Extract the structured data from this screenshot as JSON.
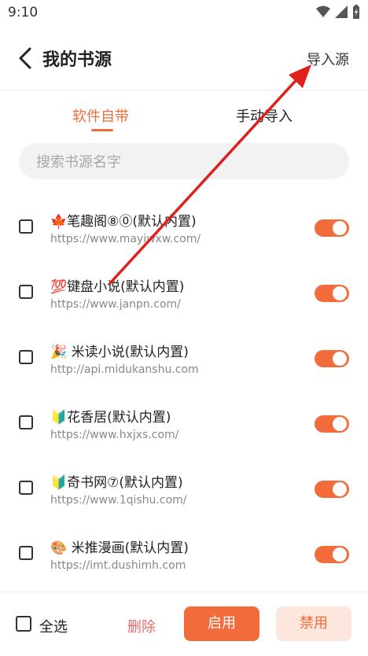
{
  "status": {
    "time": "9:10"
  },
  "header": {
    "title": "我的书源",
    "import_label": "导入源"
  },
  "tabs": [
    {
      "label": "软件自带"
    },
    {
      "label": "手动导入"
    }
  ],
  "search": {
    "placeholder": "搜索书源名字"
  },
  "sources": [
    {
      "emoji": "🍁",
      "name": "笔趣阁⑧⓪(默认内置)",
      "url": "https://www.mayiwxw.com/",
      "enabled": true
    },
    {
      "emoji": "💯",
      "name": "键盘小说(默认内置)",
      "url": "https://www.janpn.com/",
      "enabled": true
    },
    {
      "emoji": "🎉",
      "name": " 米读小说(默认内置)",
      "url": "http://api.midukanshu.com",
      "enabled": true
    },
    {
      "emoji": "🔰",
      "name": "花香居(默认内置)",
      "url": "https://www.hxjxs.com/",
      "enabled": true
    },
    {
      "emoji": "🔰",
      "name": "奇书网⑦(默认内置)",
      "url": "https://www.1qishu.com/",
      "enabled": true
    },
    {
      "emoji": "🎨",
      "name": " 米推漫画(默认内置)",
      "url": "https://imt.dushimh.com",
      "enabled": true
    }
  ],
  "bottom": {
    "select_all": "全选",
    "delete": "删除",
    "enable": "启用",
    "disable": "禁用"
  },
  "colors": {
    "accent": "#f26b3a",
    "annotation_arrow": "#e0201c"
  }
}
